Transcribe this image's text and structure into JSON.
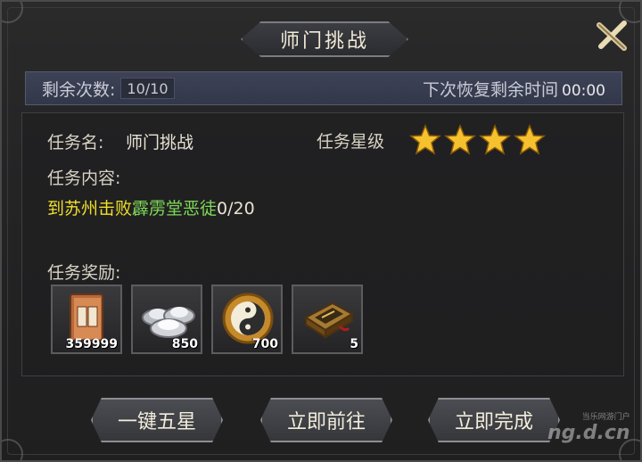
{
  "title": "师门挑战",
  "counter": {
    "label": "剩余次数:",
    "value": "10/10",
    "recover_label": "下次恢复剩余时间",
    "recover_time": "00:00"
  },
  "task": {
    "name_label": "任务名:",
    "name_value": "师门挑战",
    "stars_label": "任务星级",
    "stars": 4,
    "content_label": "任务内容:",
    "objective_part1": "到苏州击败",
    "objective_part2": "霹雳堂恶徒",
    "objective_progress": "0/20",
    "reward_label": "任务奖励:"
  },
  "rewards": [
    {
      "icon": "book-icon",
      "count": "359999"
    },
    {
      "icon": "silver-ingot-icon",
      "count": "850"
    },
    {
      "icon": "taiji-coin-icon",
      "count": "700"
    },
    {
      "icon": "manual-chest-icon",
      "count": "5"
    }
  ],
  "buttons": {
    "five_star": "一键五星",
    "go_now": "立即前往",
    "complete_now": "立即完成"
  },
  "watermark": {
    "small": "当乐网游门户",
    "big": "ng.d.cn"
  },
  "colors": {
    "objective_yellow": "#f1df2a",
    "objective_green": "#7ed957",
    "star_gold": "#f6c12e"
  }
}
